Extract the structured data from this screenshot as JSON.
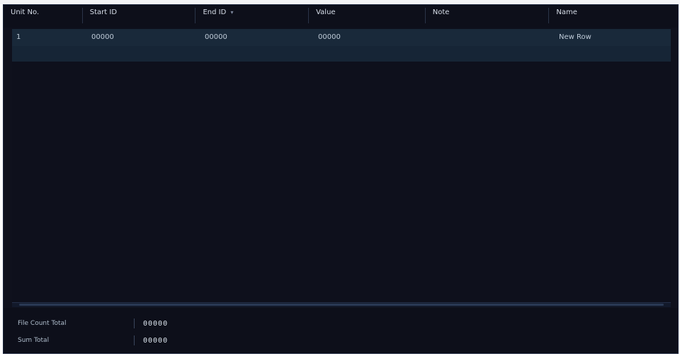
{
  "top_strip": {
    "text": ""
  },
  "table": {
    "columns": [
      {
        "label": "Unit No.",
        "sortable": false
      },
      {
        "label": "Start ID",
        "sortable": false
      },
      {
        "label": "End ID",
        "sortable": true
      },
      {
        "label": "Value",
        "sortable": false
      },
      {
        "label": "Note",
        "sortable": false
      },
      {
        "label": "Name",
        "sortable": false
      }
    ],
    "rows": [
      {
        "cells": [
          "1",
          "00000",
          "00000",
          "00000",
          "",
          "New Row"
        ],
        "selected": true
      },
      {
        "cells": [
          "",
          "",
          "",
          "",
          "",
          ""
        ],
        "selected": false
      }
    ]
  },
  "footer": {
    "row1": {
      "label": "File Count Total",
      "value": "00000"
    },
    "row2": {
      "label": "Sum Total",
      "value": "00000"
    }
  },
  "colors": {
    "background": "#0f111d",
    "selected_row": "#19293a",
    "header_text": "#d6dde8"
  },
  "icons": {
    "sort": "sort-arrow-icon"
  }
}
